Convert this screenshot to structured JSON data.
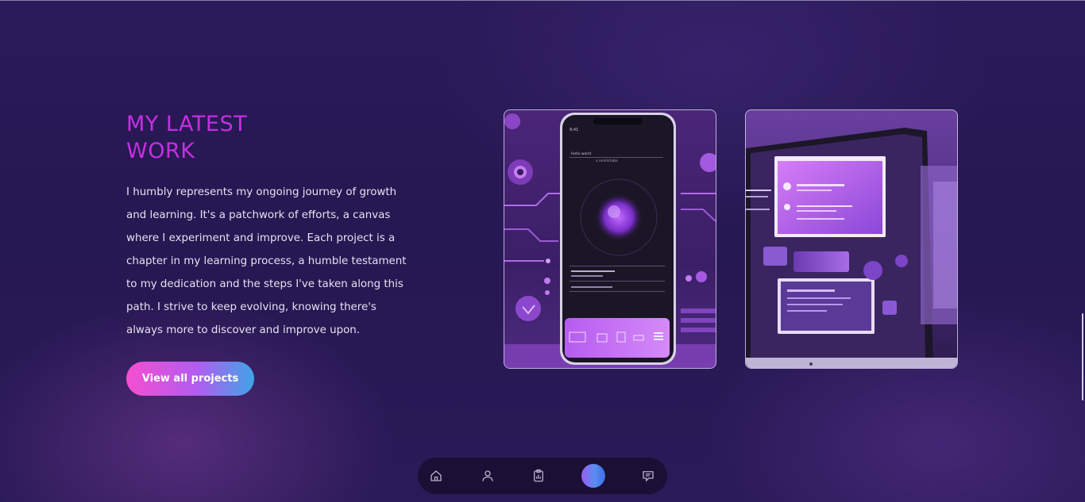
{
  "section": {
    "heading_line1": "MY LATEST",
    "heading_line2": "WORK",
    "description": "I humbly represents my ongoing journey of growth and learning. It's a patchwork of efforts, a canvas where I experiment and improve. Each project is a chapter in my learning process, a humble testament to my dedication and the steps I've taken along this path. I strive to keep evolving, knowing there's always more to discover and improve upon.",
    "cta_label": "View all projects"
  },
  "projects": [
    {
      "icon": "mobile-app-illustration",
      "phone_status_left": "9:41",
      "phone_title": "Hello world",
      "phone_subtitle": "a comfortable"
    },
    {
      "icon": "web-dashboard-illustration"
    }
  ],
  "dock": {
    "items": [
      {
        "icon": "home-icon"
      },
      {
        "icon": "user-icon"
      },
      {
        "icon": "clipboard-chart-icon"
      },
      {
        "icon": "work-icon",
        "active": true
      },
      {
        "icon": "chat-icon"
      }
    ]
  },
  "colors": {
    "accent_heading": "#c62fe0",
    "button_gradient_start": "#f54fd0",
    "button_gradient_end": "#3fa5e8",
    "background": "#2b1a5a"
  }
}
